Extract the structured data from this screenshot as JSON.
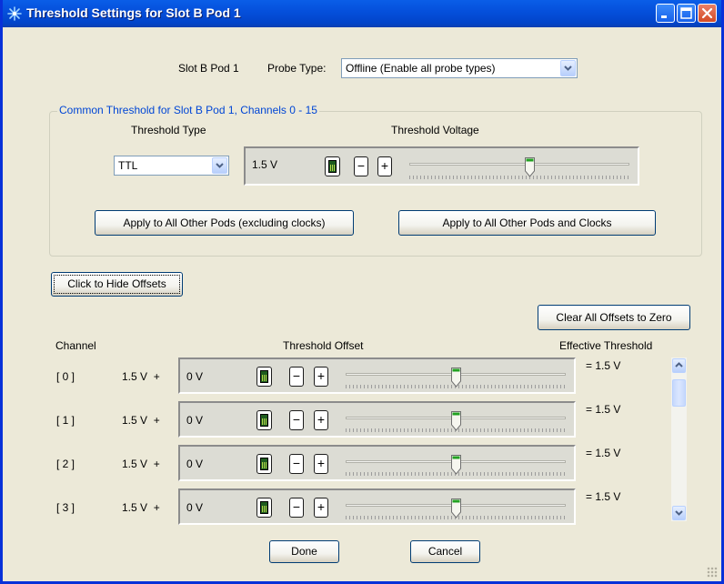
{
  "window": {
    "title": "Threshold Settings for Slot B Pod 1"
  },
  "pod_label": "Slot B Pod 1",
  "probe_type": {
    "label": "Probe Type:",
    "value": "Offline (Enable all probe types)"
  },
  "common": {
    "group_label": "Common Threshold for Slot B Pod 1, Channels 0 - 15",
    "threshold_type_label": "Threshold Type",
    "threshold_voltage_label": "Threshold Voltage",
    "threshold_type_value": "TTL",
    "voltage_value": "1.5 V",
    "slider_level": 0.55,
    "apply_excluding_label": "Apply to All Other Pods (excluding clocks)",
    "apply_including_label": "Apply to All Other Pods and Clocks"
  },
  "hide_offsets_label": "Click to Hide Offsets",
  "clear_offsets_label": "Clear All Offsets to Zero",
  "columns": {
    "channel": "Channel",
    "offset": "Threshold Offset",
    "effective": "Effective Threshold"
  },
  "channels": [
    {
      "name": "[ 0 ]",
      "base": "1.5 V  +",
      "offset": "0 V",
      "effective": "= 1.5 V",
      "slider_level": 0.5
    },
    {
      "name": "[ 1 ]",
      "base": "1.5 V  +",
      "offset": "0 V",
      "effective": "= 1.5 V",
      "slider_level": 0.5
    },
    {
      "name": "[ 2 ]",
      "base": "1.5 V  +",
      "offset": "0 V",
      "effective": "= 1.5 V",
      "slider_level": 0.5
    },
    {
      "name": "[ 3 ]",
      "base": "1.5 V  +",
      "offset": "0 V",
      "effective": "= 1.5 V",
      "slider_level": 0.5
    }
  ],
  "stepper": {
    "minus": "−",
    "plus": "+"
  },
  "footer": {
    "done_label": "Done",
    "cancel_label": "Cancel"
  },
  "icons": {
    "app": "asterisk-icon",
    "calculator": "calculator-icon",
    "dropdown": "chevron-down-icon"
  },
  "colors": {
    "titlebar": "#0550dc",
    "window_bg": "#ece9d8",
    "group_label": "#0046d5",
    "close_button": "#d44b26"
  }
}
